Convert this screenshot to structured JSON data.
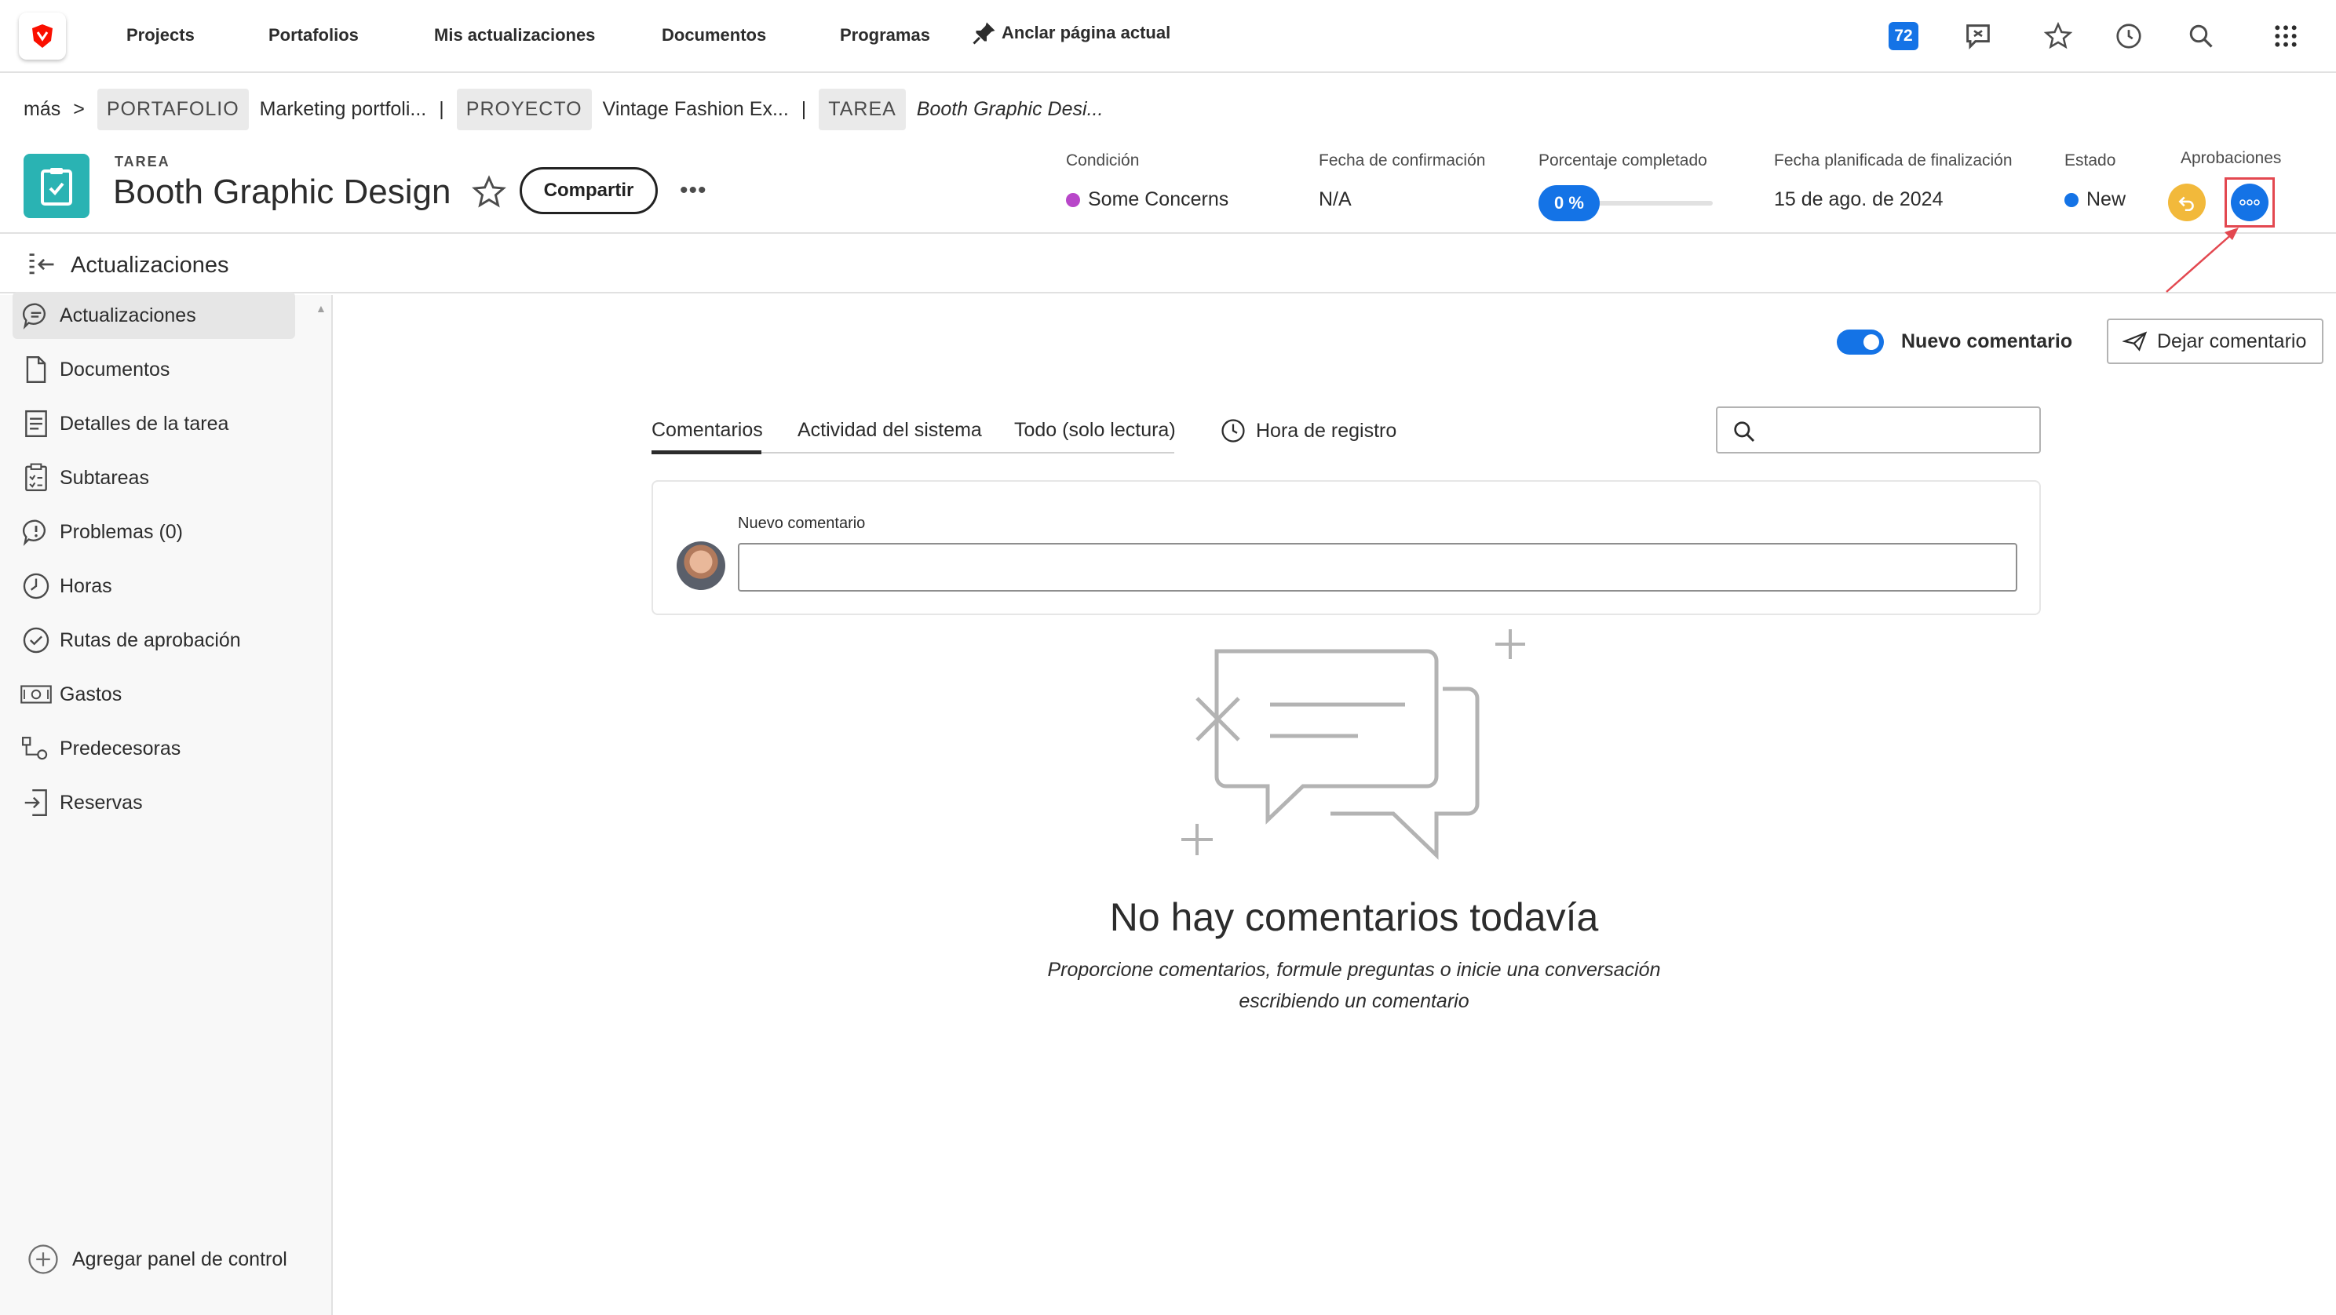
{
  "nav": {
    "links": [
      "Projects",
      "Portafolios",
      "Mis actualizaciones",
      "Documentos",
      "Programas"
    ],
    "pin_label": "Anclar página actual",
    "badge_count": "72",
    "icons": [
      "updates-icon",
      "star-icon",
      "history-icon",
      "search-icon",
      "apps-grid-icon"
    ]
  },
  "breadcrumb": {
    "more": "más",
    "sep_arrow": ">",
    "portfolio_type": "PORTAFOLIO",
    "portfolio_name": "Marketing portfoli...",
    "project_type": "PROYECTO",
    "project_name": "Vintage Fashion Ex...",
    "task_type": "TAREA",
    "task_name": "Booth Graphic Desi...",
    "divider": "|"
  },
  "header": {
    "object_type": "TAREA",
    "title": "Booth Graphic Design",
    "share_label": "Compartir",
    "more_label": "•••",
    "fields": {
      "condition_label": "Condición",
      "condition_value": "Some Concerns",
      "condition_color": "#b847c9",
      "commit_label": "Fecha de confirmación",
      "commit_value": "N/A",
      "percent_label": "Porcentaje completado",
      "percent_value": "0 %",
      "percent_fraction": 0,
      "planned_label": "Fecha planificada de finalización",
      "planned_value": "15 de ago. de 2024",
      "status_label": "Estado",
      "status_value": "New",
      "status_color": "#1473e6",
      "approvals_label": "Aprobaciones"
    }
  },
  "updates_bar": {
    "title": "Actualizaciones"
  },
  "sidebar": {
    "items": [
      {
        "label": "Actualizaciones",
        "icon": "comment-icon",
        "active": true
      },
      {
        "label": "Documentos",
        "icon": "document-icon"
      },
      {
        "label": "Detalles de la tarea",
        "icon": "details-icon"
      },
      {
        "label": "Subtareas",
        "icon": "subtasks-icon"
      },
      {
        "label": "Problemas (0)",
        "icon": "issues-icon"
      },
      {
        "label": "Horas",
        "icon": "clock-icon"
      },
      {
        "label": "Rutas de aprobación",
        "icon": "approval-check-icon"
      },
      {
        "label": "Gastos",
        "icon": "money-icon"
      },
      {
        "label": "Predecesoras",
        "icon": "predecessors-icon"
      },
      {
        "label": "Reservas",
        "icon": "bookings-icon"
      }
    ],
    "add_panel": "Agregar panel de control"
  },
  "main": {
    "toggle_label": "Nuevo comentario",
    "toggle_on": true,
    "leave_comment": "Dejar comentario",
    "tabs": [
      "Comentarios",
      "Actividad del sistema",
      "Todo (solo lectura)"
    ],
    "active_tab": "Comentarios",
    "hora": "Hora de registro",
    "search_placeholder": "",
    "new_comment_label": "Nuevo comentario",
    "empty_title": "No hay comentarios todavía",
    "empty_desc": "Proporcione comentarios, formule preguntas o inicie una conversación escribiendo un comentario"
  },
  "colors": {
    "accent": "#1473e6",
    "task_teal": "#2ab3b3",
    "approval_yellow": "#f2b93b",
    "annotation_red": "#e34850"
  }
}
